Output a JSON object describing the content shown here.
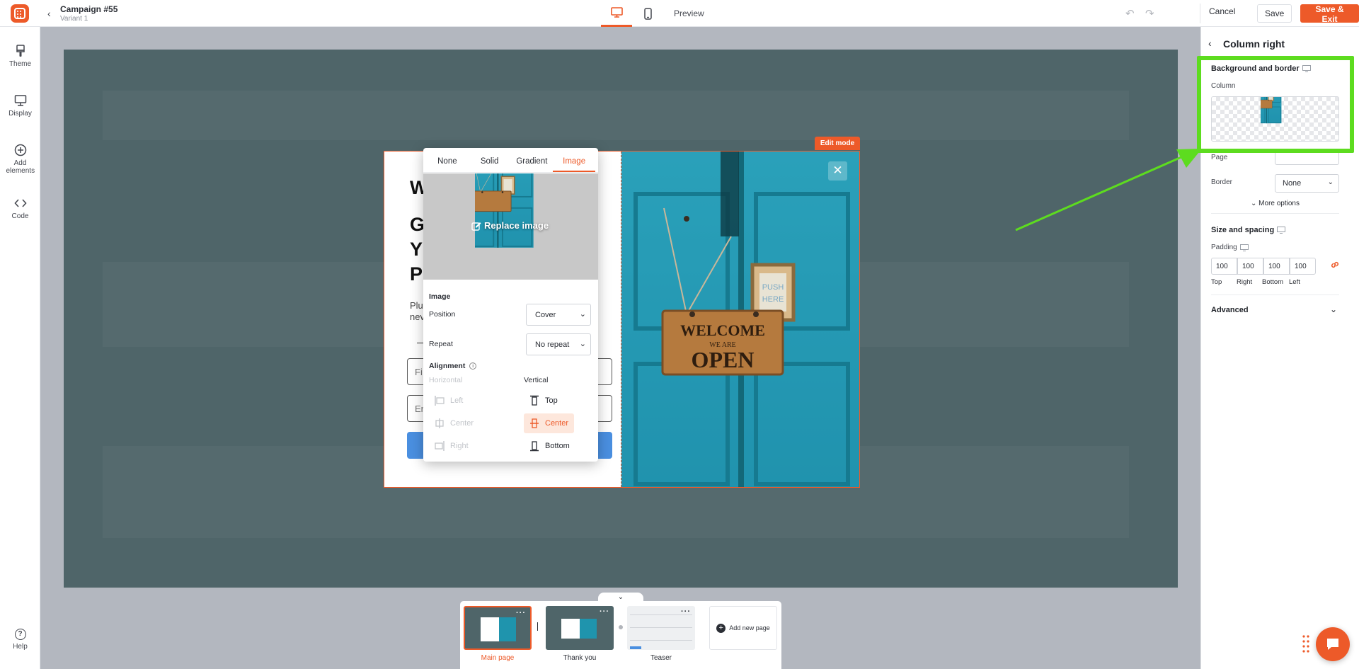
{
  "app": {
    "campaign_title": "Campaign #55",
    "variant": "Variant 1",
    "preview_label": "Preview",
    "cancel_label": "Cancel",
    "save_label": "Save",
    "save_exit_label": "Save & Exit",
    "accent_color": "#ed5a29"
  },
  "sidebar": {
    "items": [
      {
        "label": "Theme",
        "icon": "paintbrush-icon"
      },
      {
        "label": "Display",
        "icon": "monitor-icon"
      },
      {
        "label": "Add elements",
        "icon": "plus-circle-icon"
      },
      {
        "label": "Code",
        "icon": "code-icon"
      }
    ],
    "help_label": "Help"
  },
  "canvas": {
    "edit_mode_label": "Edit mode",
    "popup_left": {
      "heading_1": "W",
      "heading_2_lines": [
        "G",
        "Y",
        "P"
      ],
      "body_lines": [
        "Plu",
        "nev"
      ],
      "field_1_text": "Fi",
      "field_2_text": "Er"
    },
    "hero_image": {
      "sign_top": "WELCOME",
      "sign_mid": "WE ARE",
      "sign_bottom": "OPEN",
      "push_text_1": "PUSH",
      "push_text_2": "HERE"
    }
  },
  "picker": {
    "tabs": [
      "None",
      "Solid",
      "Gradient",
      "Image"
    ],
    "active_tab": "Image",
    "replace_label": "Replace image",
    "image_section": "Image",
    "position_label": "Position",
    "position_value": "Cover",
    "repeat_label": "Repeat",
    "repeat_value": "No repeat",
    "alignment_label": "Alignment",
    "horizontal_label": "Horizontal",
    "vertical_label": "Vertical",
    "horizontal_options": [
      "Left",
      "Center",
      "Right"
    ],
    "vertical_options": [
      "Top",
      "Center",
      "Bottom"
    ],
    "vertical_selected": "Center"
  },
  "pages": {
    "items": [
      {
        "name": "Main page",
        "active": true
      },
      {
        "name": "Thank you",
        "active": false
      },
      {
        "name": "Teaser",
        "active": false
      }
    ],
    "add_label": "Add new page"
  },
  "panel": {
    "title": "Column right",
    "bg_section": "Background and border",
    "column_label": "Column",
    "page_label": "Page",
    "border_label": "Border",
    "border_value": "None",
    "more_options": "More options",
    "size_section": "Size and spacing",
    "padding_label": "Padding",
    "padding_values": [
      "100",
      "100",
      "100",
      "100"
    ],
    "padding_captions": [
      "Top",
      "Right",
      "Bottom",
      "Left"
    ],
    "advanced_label": "Advanced"
  },
  "highlight_color": "#5ddc1f"
}
